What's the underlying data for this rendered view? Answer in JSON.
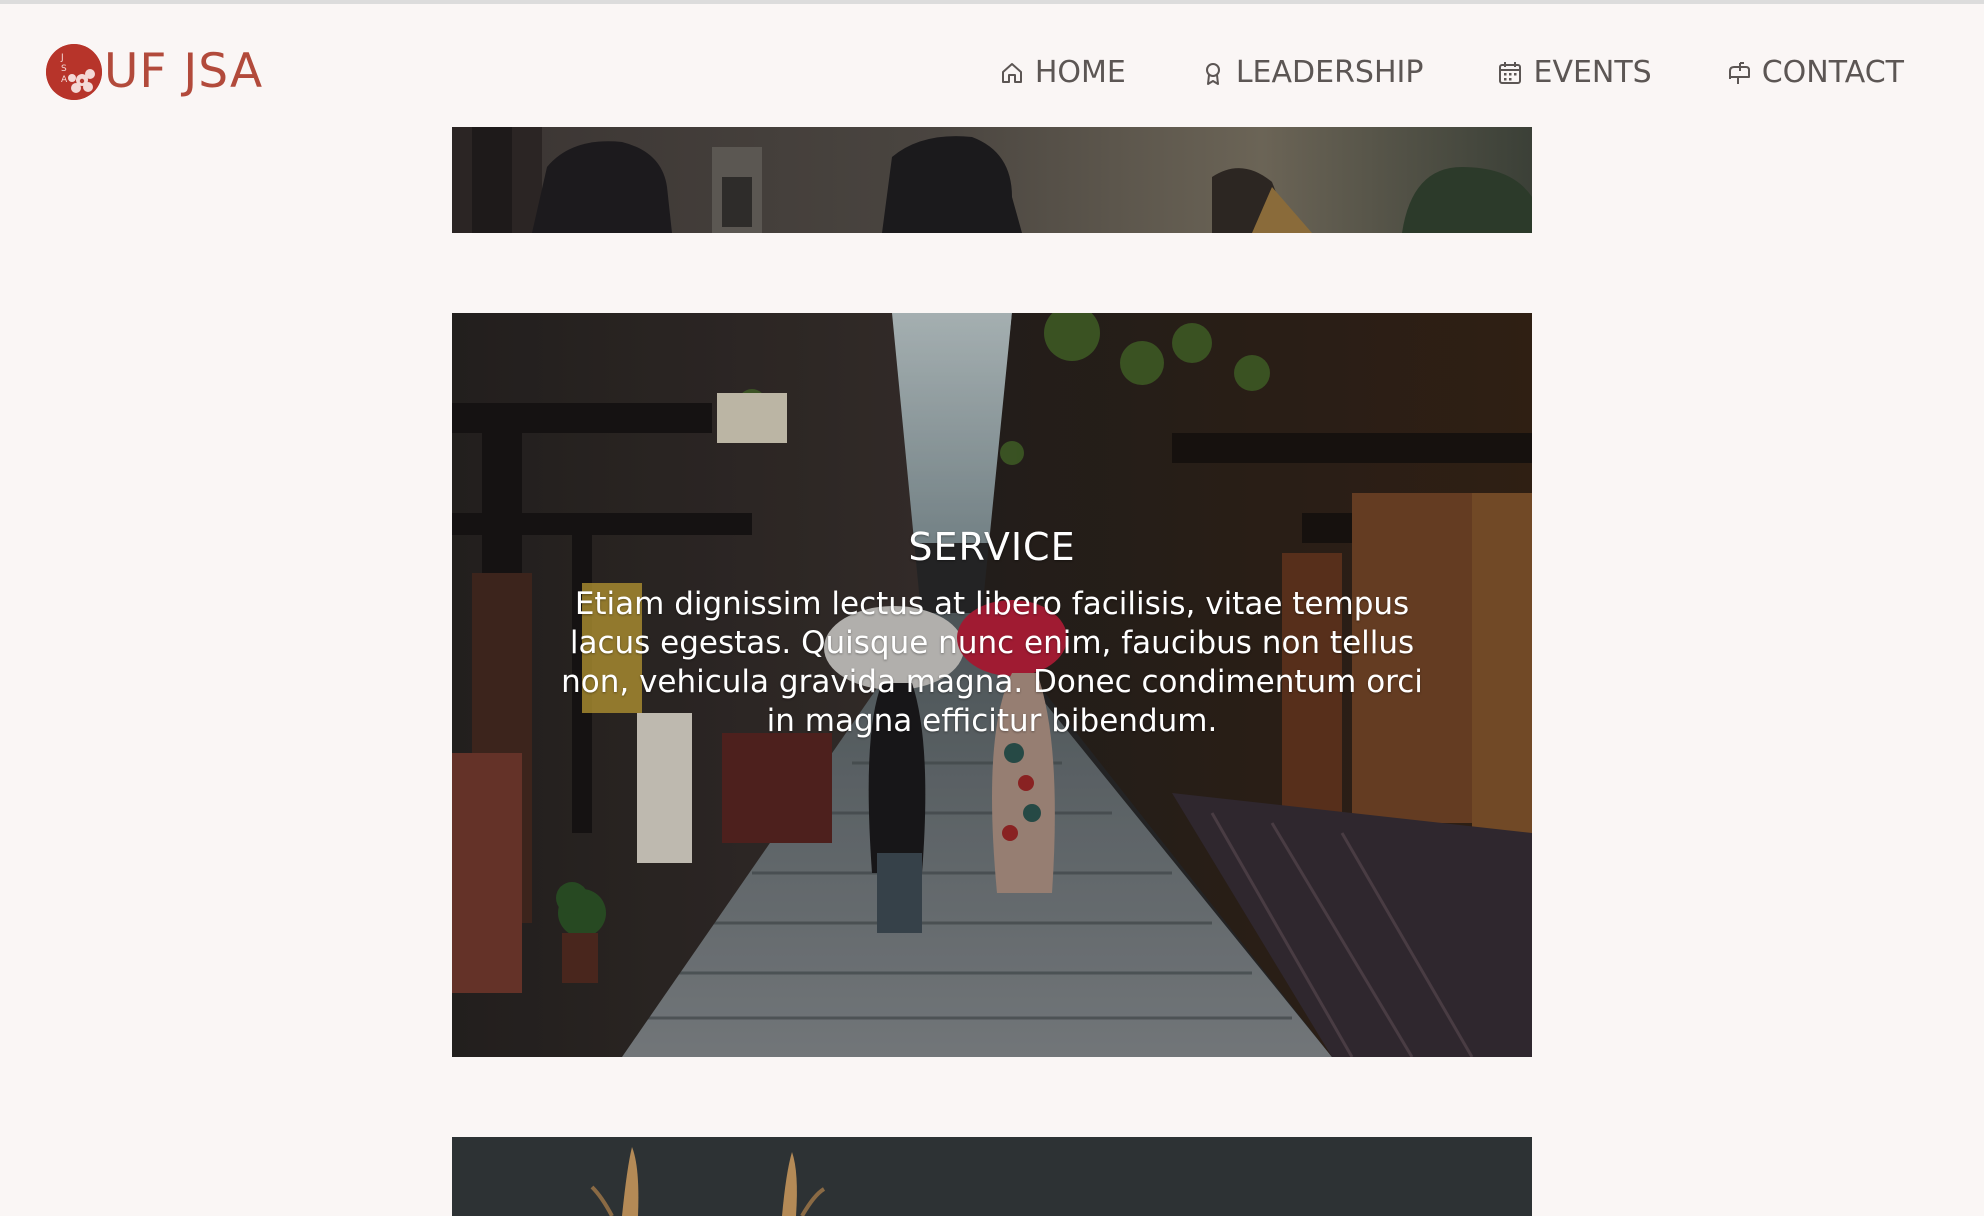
{
  "brand": {
    "name": "UF JSA",
    "logo_letters": "JSA",
    "primary_color": "#b7342a"
  },
  "nav": {
    "items": [
      {
        "label": "HOME",
        "icon": "home-icon"
      },
      {
        "label": "LEADERSHIP",
        "icon": "award-icon"
      },
      {
        "label": "EVENTS",
        "icon": "calendar-icon"
      },
      {
        "label": "CONTACT",
        "icon": "mailbox-icon"
      }
    ]
  },
  "sections": [
    {
      "title": "",
      "body": "",
      "image": "street-scene-partial"
    },
    {
      "title": "SERVICE",
      "body": "Etiam dignissim lectus at libero facilisis, vitae tempus lacus egestas. Quisque nunc enim, faucibus non tellus non, vehicula gravida magna. Donec condimentum orci in magna efficitur bibendum.",
      "image": "kyoto-alley-kimono-umbrella"
    },
    {
      "title": "",
      "body": "",
      "image": "dark-scene-partial"
    }
  ]
}
